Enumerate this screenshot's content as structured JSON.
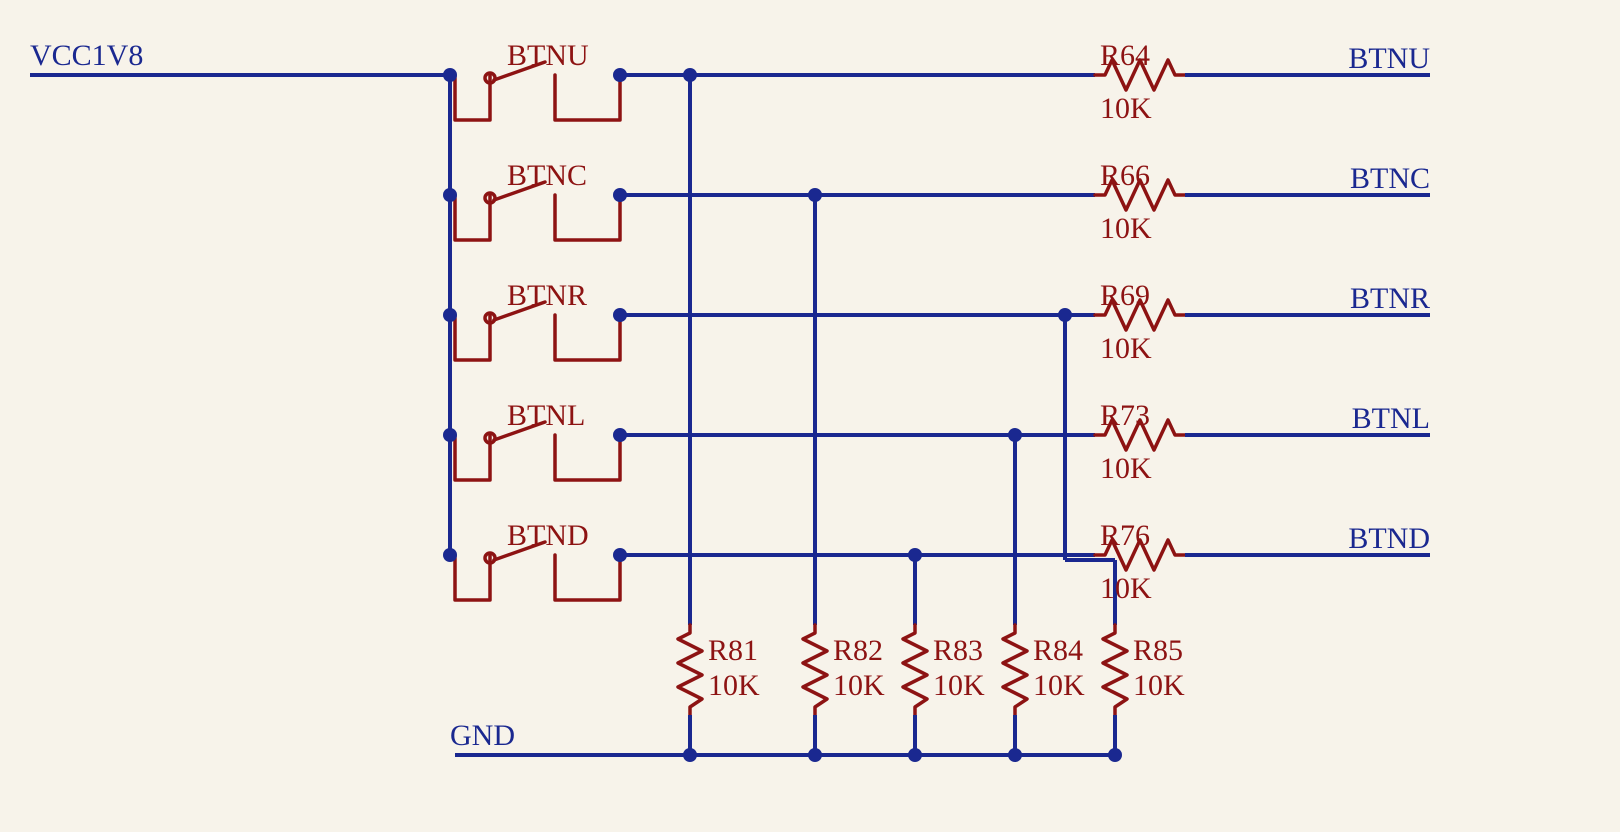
{
  "nets": {
    "vcc": "VCC1V8",
    "gnd": "GND",
    "out": [
      "BTNU",
      "BTNC",
      "BTNR",
      "BTNL",
      "BTND"
    ]
  },
  "buttons": [
    "BTNU",
    "BTNC",
    "BTNR",
    "BTNL",
    "BTND"
  ],
  "series_resistors": [
    {
      "ref": "R64",
      "val": "10K"
    },
    {
      "ref": "R66",
      "val": "10K"
    },
    {
      "ref": "R69",
      "val": "10K"
    },
    {
      "ref": "R73",
      "val": "10K"
    },
    {
      "ref": "R76",
      "val": "10K"
    }
  ],
  "pulldown_resistors": [
    {
      "ref": "R81",
      "val": "10K"
    },
    {
      "ref": "R82",
      "val": "10K"
    },
    {
      "ref": "R83",
      "val": "10K"
    },
    {
      "ref": "R84",
      "val": "10K"
    },
    {
      "ref": "R85",
      "val": "10K"
    }
  ]
}
